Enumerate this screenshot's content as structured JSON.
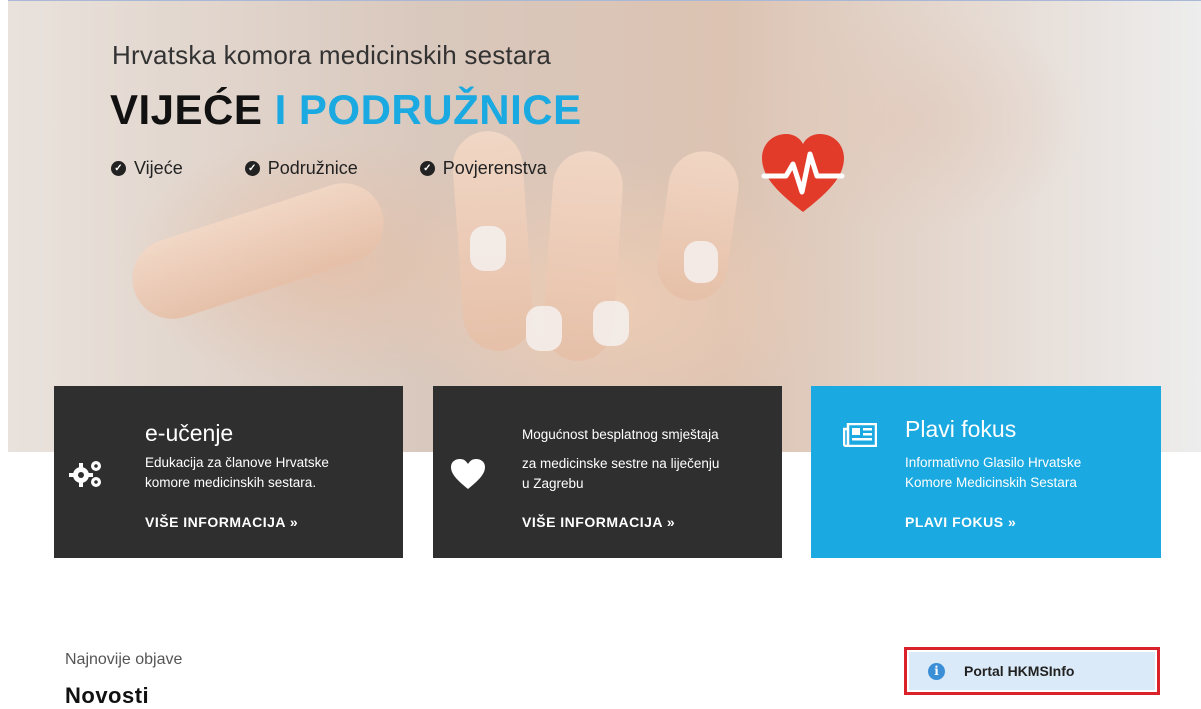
{
  "hero": {
    "subtitle": "Hrvatska komora medicinskih sestara",
    "title_part1": "VIJEĆE",
    "title_part2": "I PODRUŽNICE",
    "links": [
      {
        "label": "Vijeće"
      },
      {
        "label": "Podružnice"
      },
      {
        "label": "Povjerenstva"
      }
    ],
    "logo_icon": "heart-pulse-icon"
  },
  "cards": [
    {
      "title": "e-učenje",
      "description_line1": "Edukacija za članove Hrvatske",
      "description_line2": "komore medicinskih sestara.",
      "link": "VIŠE INFORMACIJA  »",
      "icon": "gears-icon"
    },
    {
      "description_line1": "Mogućnost besplatnog smještaja",
      "description_line2": "za medicinske sestre na liječenju",
      "description_line3": "u Zagrebu",
      "link": "VIŠE INFORMACIJA  »",
      "icon": "heart-icon"
    },
    {
      "title": "Plavi fokus",
      "description_line1": "Informativno Glasilo Hrvatske",
      "description_line2": "Komore Medicinskih Sestara",
      "link": "PLAVI FOKUS  »",
      "icon": "newspaper-icon"
    }
  ],
  "latest": {
    "label": "Najnovije objave",
    "title": "Novosti"
  },
  "portal": {
    "label": "Portal HKMSInfo",
    "icon": "info-icon"
  },
  "colors": {
    "accent": "#1aa9e0",
    "dark_card": "#2f2f2f",
    "highlight_border": "#d9222a",
    "logo_red": "#e23b2a"
  }
}
